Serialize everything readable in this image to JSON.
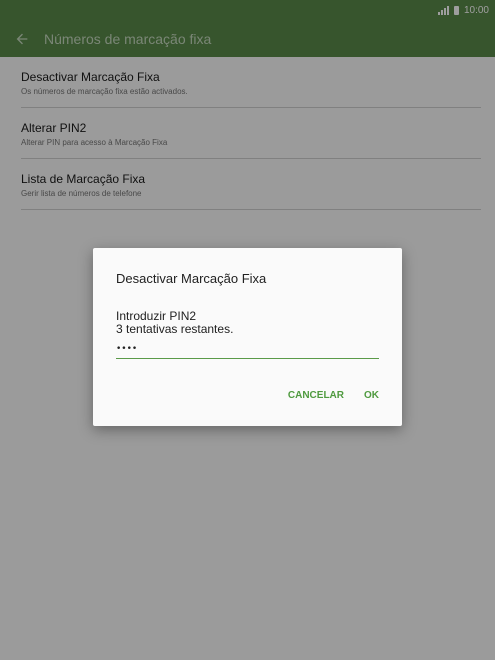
{
  "status_bar": {
    "time": "10:00",
    "signal_icon": "signal-icon",
    "battery_icon": "battery-icon"
  },
  "app_bar": {
    "title": "Números de marcação fixa",
    "back_icon": "arrow-back-icon"
  },
  "settings": {
    "items": [
      {
        "title": "Desactivar Marcação Fixa",
        "subtitle": "Os números de marcação fixa estão activados."
      },
      {
        "title": "Alterar PIN2",
        "subtitle": "Alterar PIN para acesso à Marcação Fixa"
      },
      {
        "title": "Lista de Marcação Fixa",
        "subtitle": "Gerir lista de números de telefone"
      }
    ]
  },
  "dialog": {
    "title": "Desactivar Marcação Fixa",
    "message_line1": "Introduzir PIN2",
    "message_line2": "3 tentativas restantes.",
    "pin_value": "••••",
    "cancel_label": "CANCELAR",
    "ok_label": "OK"
  },
  "colors": {
    "accent": "#5a8a4a",
    "button_text": "#4f9a3f"
  }
}
